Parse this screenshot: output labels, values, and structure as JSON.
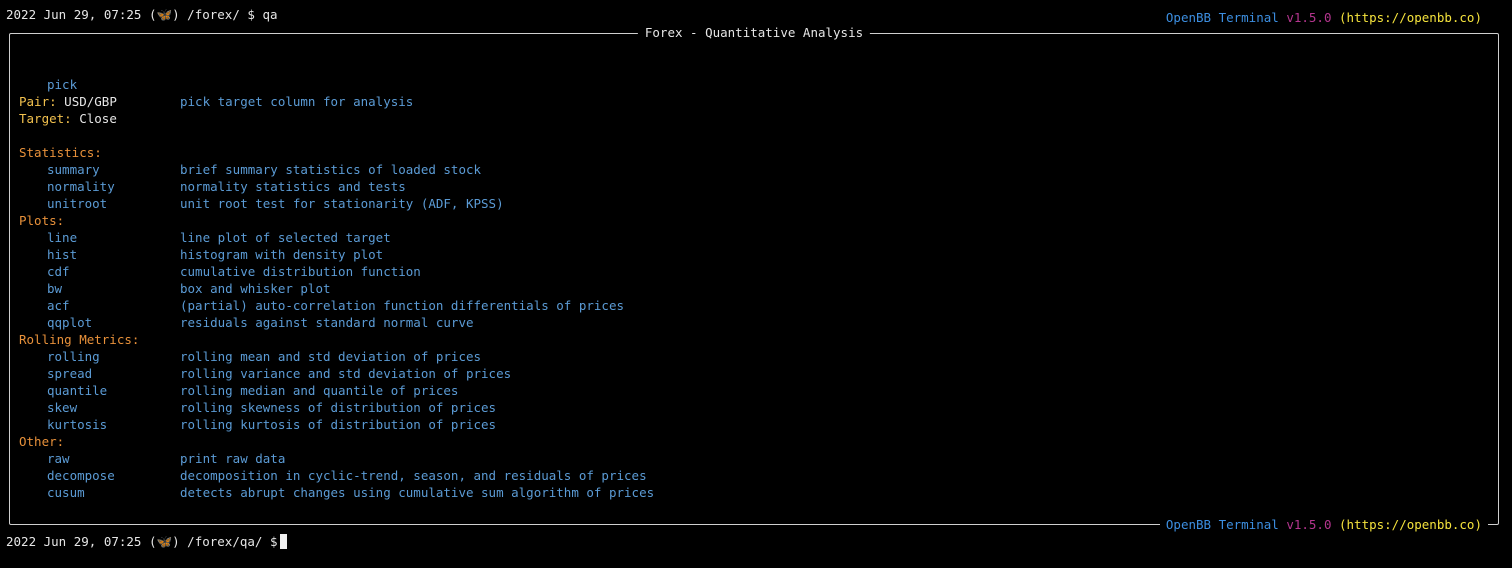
{
  "header": {
    "brand_name": "OpenBB Terminal",
    "version": "v1.5.0",
    "url": "(https://openbb.co)"
  },
  "prompt_top": {
    "datetime": "2022 Jun 29, 07:25",
    "icon": "butterfly-icon",
    "path": "/forex/ $",
    "command": "qa"
  },
  "panel": {
    "title": "Forex - Quantitative Analysis",
    "pick": {
      "cmd": "pick",
      "desc": "pick target column for analysis"
    },
    "pair": {
      "label": "Pair:",
      "value": "USD/GBP"
    },
    "target": {
      "label": "Target:",
      "value": "Close"
    },
    "sections": [
      {
        "title": "Statistics:",
        "items": [
          {
            "cmd": "summary",
            "desc": "brief summary statistics of loaded stock"
          },
          {
            "cmd": "normality",
            "desc": "normality statistics and tests"
          },
          {
            "cmd": "unitroot",
            "desc": "unit root test for stationarity (ADF, KPSS)"
          }
        ]
      },
      {
        "title": "Plots:",
        "items": [
          {
            "cmd": "line",
            "desc": "line plot of selected target"
          },
          {
            "cmd": "hist",
            "desc": "histogram with density plot"
          },
          {
            "cmd": "cdf",
            "desc": "cumulative distribution function"
          },
          {
            "cmd": "bw",
            "desc": "box and whisker plot"
          },
          {
            "cmd": "acf",
            "desc": "(partial) auto-correlation function differentials of prices"
          },
          {
            "cmd": "qqplot",
            "desc": "residuals against standard normal curve"
          }
        ]
      },
      {
        "title": "Rolling Metrics:",
        "items": [
          {
            "cmd": "rolling",
            "desc": "rolling mean and std deviation of prices"
          },
          {
            "cmd": "spread",
            "desc": "rolling variance and std deviation of prices"
          },
          {
            "cmd": "quantile",
            "desc": "rolling median and quantile of prices"
          },
          {
            "cmd": "skew",
            "desc": "rolling skewness of distribution of prices"
          },
          {
            "cmd": "kurtosis",
            "desc": "rolling kurtosis of distribution of prices"
          }
        ]
      },
      {
        "title": "Other:",
        "items": [
          {
            "cmd": "raw",
            "desc": "print raw data"
          },
          {
            "cmd": "decompose",
            "desc": "decomposition in cyclic-trend, season, and residuals of prices"
          },
          {
            "cmd": "cusum",
            "desc": "detects abrupt changes using cumulative sum algorithm of prices"
          }
        ]
      }
    ],
    "footer": {
      "brand_name": "OpenBB Terminal",
      "version": "v1.5.0",
      "url": "(https://openbb.co)"
    }
  },
  "prompt_bottom": {
    "datetime": "2022 Jun 29, 07:25",
    "icon": "butterfly-icon",
    "path": "/forex/qa/ $",
    "command": ""
  },
  "colors": {
    "command_blue": "#5b9bd5",
    "section_orange": "#e8913a",
    "label_yellow": "#f2c14e",
    "brand_blue": "#3c8ee0",
    "brand_magenta": "#b4358e",
    "brand_yellow": "#f5e33c"
  }
}
